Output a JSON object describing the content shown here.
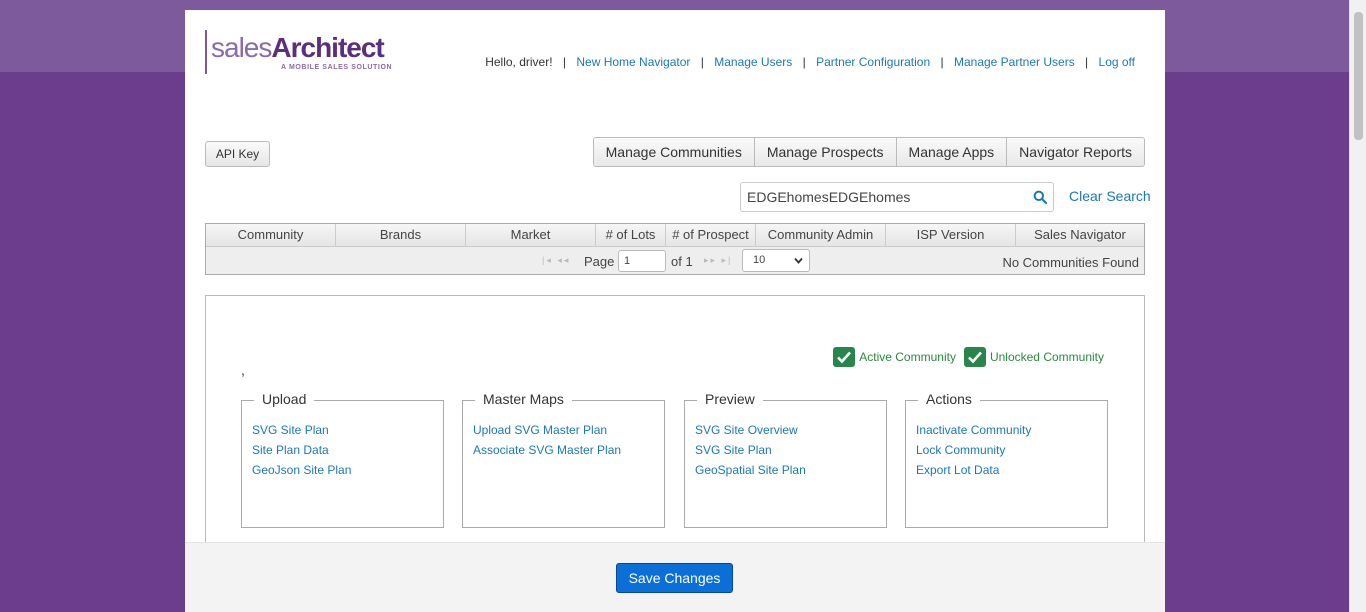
{
  "logo": {
    "sales": "sales",
    "architect": "Architect",
    "tagline": "A MOBILE SALES SOLUTION"
  },
  "topnav": {
    "greeting": "Hello, driver!",
    "links": [
      "New Home Navigator",
      "Manage Users",
      "Partner Configuration",
      "Manage Partner Users",
      "Log off"
    ]
  },
  "api_key_label": "API Key",
  "tabs": [
    "Manage Communities",
    "Manage Prospects",
    "Manage Apps",
    "Navigator Reports"
  ],
  "search": {
    "value": "EDGEhomesEDGEhomes",
    "clear_label": "Clear Search"
  },
  "grid": {
    "columns": [
      "Community",
      "Brands",
      "Market",
      "# of Lots",
      "# of Prospect",
      "Community Admin",
      "ISP Version",
      "Sales Navigator"
    ],
    "pager": {
      "page_label": "Page",
      "page_value": "1",
      "of_label": "of 1",
      "page_size": "10",
      "status": "No Communities Found"
    }
  },
  "community": {
    "name_placeholder": ",",
    "active_label": "Active Community",
    "unlocked_label": "Unlocked Community"
  },
  "sections": [
    {
      "title": "Upload",
      "links": [
        "SVG Site Plan",
        "Site Plan Data",
        "GeoJson Site Plan"
      ]
    },
    {
      "title": "Master Maps",
      "links": [
        "Upload SVG Master Plan",
        "Associate SVG Master Plan"
      ]
    },
    {
      "title": "Preview",
      "links": [
        "SVG Site Overview",
        "SVG Site Plan",
        "GeoSpatial Site Plan"
      ]
    },
    {
      "title": "Actions",
      "links": [
        "Inactivate Community",
        "Lock Community",
        "Export Lot Data"
      ]
    }
  ],
  "save_label": "Save Changes",
  "colors": {
    "link": "#1a78b9",
    "background": "#6b3d8c",
    "primary_button": "#0a6fd6",
    "check": "#27874a"
  }
}
